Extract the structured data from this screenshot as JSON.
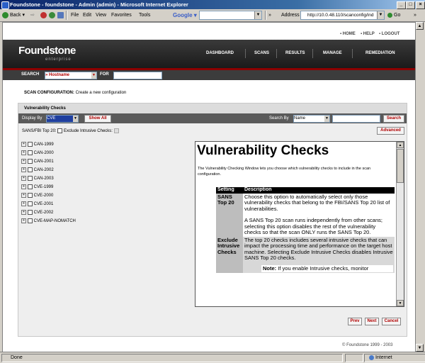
{
  "window": {
    "title": "Foundstone - foundstone - Admin (admin) - Microsoft Internet Explorer",
    "minimize": "_",
    "maximize": "□",
    "close": "×"
  },
  "toolbar": {
    "back": "Back",
    "forward": "⇨",
    "menus": [
      "File",
      "Edit",
      "View",
      "Favorites",
      "Tools"
    ],
    "google": "Google",
    "address_label": "Address",
    "address": "http://10.0.48.110/scanconfig/ind",
    "go": "Go",
    "links": "»"
  },
  "topnav": [
    "HOME",
    "HELP",
    "LOGOUT"
  ],
  "header": {
    "logo": "Foundstone",
    "logo_sub": "enterprise",
    "nav": [
      "DASHBOARD",
      "SCANS",
      "RESULTS",
      "MANAGE",
      "REMEDIATION"
    ]
  },
  "searchbar": {
    "search_label": "SEARCH",
    "search_select": "» Hostname",
    "for_label": "FOR"
  },
  "scan_config": {
    "label": "SCAN CONFIGURATION:",
    "text": "Create a new configuration"
  },
  "panel": {
    "title": "Vulnerability Checks",
    "display_by_label": "Display By",
    "display_by_value": "CVE",
    "show_all": "Show All",
    "search_by_label": "Search By",
    "search_by_value": "Name",
    "search_button": "Search",
    "sans_label": "SANS/FBI Top 20:",
    "exclude_label": "Exclude Intrusive Checks:",
    "advanced": "Advanced",
    "tree": [
      "CAN-1999",
      "CAN-2000",
      "CAN-2001",
      "CAN-2002",
      "CAN-2003",
      "CVE-1999",
      "CVE-2000",
      "CVE-2001",
      "CVE-2002",
      "CVE-MAP-NOMATCH"
    ]
  },
  "help": {
    "heading": "Vulnerability Checks",
    "intro": "The Vulnerability Checking Window lets you choose which vulnerability checks to include in the scan configuration.",
    "col_setting": "Setting",
    "col_description": "Description",
    "row1_key": "SANS Top 20",
    "row1_p1": "Choose this option to automatically select only those vulnerability checks that belong to the FBI/SANS Top 20 list of vulnerabilities.",
    "row1_p2": "A SANS Top 20 scan runs independently from other scans; selecting this option disables the rest of the vulnerability checks so that the scan ONLY runs the SANS Top 20.",
    "row2_key": "Exclude Intrusive Checks",
    "row2_p1": "The top 20 checks includes several intrusive checks that can impact the processing time and performance on the target host machine. Selecting Exclude Intrusive Checks disables Intrusive SANS Top 20 checks.",
    "note_label": "Note:",
    "note_text": "If you enable Intrusive checks, monitor"
  },
  "wizard": {
    "prev": "Prev",
    "next": "Next",
    "cancel": "Cancel"
  },
  "footer": "© Foundstone 1999 - 2003",
  "status": {
    "text": "Done",
    "zone": "Internet"
  }
}
